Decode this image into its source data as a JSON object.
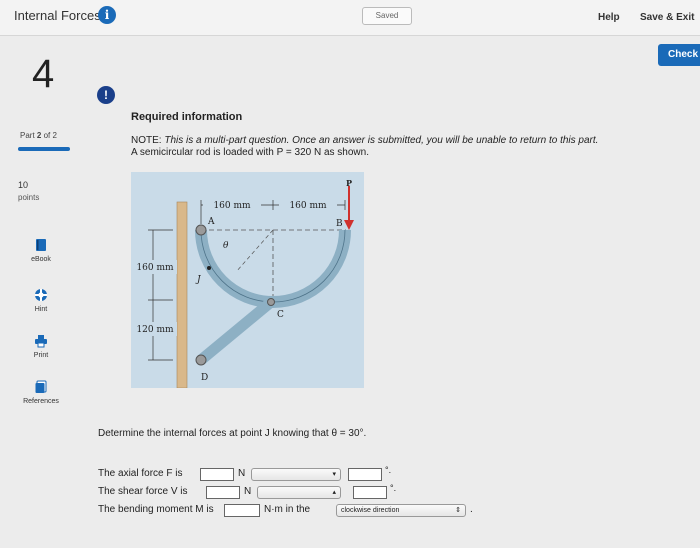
{
  "header": {
    "title": "Internal Forces",
    "info_icon": "info-icon",
    "saved": "Saved",
    "help": "Help",
    "save_exit": "Save & Exit",
    "check": "Check"
  },
  "sidebar": {
    "question_number": "4",
    "part_prefix": "Part",
    "part_current": "2",
    "part_of": "of 2",
    "points_value": "10",
    "points_label": "points",
    "tools": [
      {
        "label": "eBook",
        "icon": "book-icon"
      },
      {
        "label": "Hint",
        "icon": "hint-icon"
      },
      {
        "label": "Print",
        "icon": "print-icon"
      },
      {
        "label": "References",
        "icon": "references-icon"
      }
    ]
  },
  "content": {
    "title": "Required information",
    "note_prefix": "NOTE:",
    "note_text": "This is a multi-part question. Once an answer is submitted, you will be unable to return to this part.",
    "description": "A semicircular rod is loaded with P = 320 N as shown.",
    "question": "Determine the internal forces at point J knowing that θ = 30°."
  },
  "figure": {
    "dim_top_left": "160 mm",
    "dim_top_right": "160 mm",
    "dim_left_upper": "160 mm",
    "dim_left_lower": "120 mm",
    "label_P": "P",
    "label_A": "A",
    "label_B": "B",
    "label_C": "C",
    "label_D": "D",
    "label_J": "J",
    "label_theta": "θ"
  },
  "answers": [
    {
      "label": "The axial force F is",
      "unit": "N",
      "input_value": "",
      "select_value": "",
      "select_arrow": "▾"
    },
    {
      "label": "The shear force V is",
      "unit": "N",
      "input_value": "",
      "select_value": "",
      "select_arrow": "▴"
    },
    {
      "label": "The bending moment M is",
      "unit": "N·m in the",
      "input_value": "",
      "select_value": "clockwise direction",
      "select_arrow": "⇕"
    }
  ],
  "colors": {
    "accent": "#1a6ab8",
    "figure_bg": "#c9dbe8",
    "load_arrow": "#d0312d"
  }
}
